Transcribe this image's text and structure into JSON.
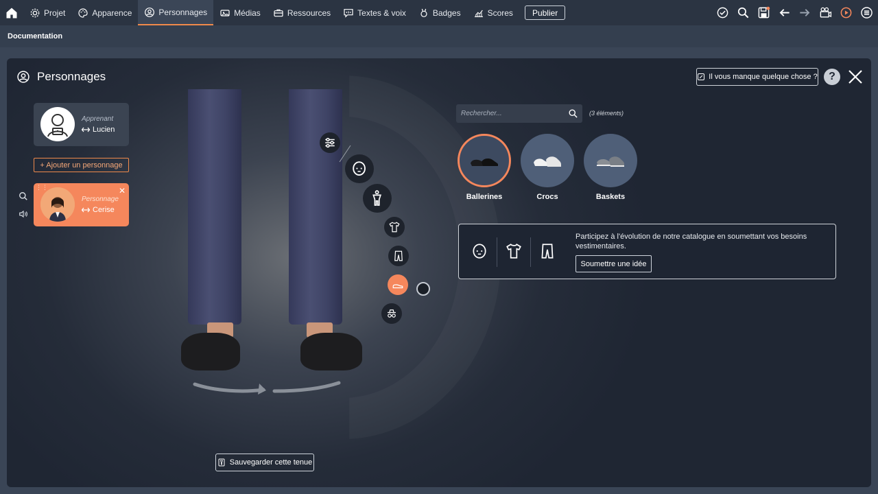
{
  "topbar": {
    "items": [
      {
        "label": "Projet",
        "icon": "gear-icon"
      },
      {
        "label": "Apparence",
        "icon": "palette-icon"
      },
      {
        "label": "Personnages",
        "icon": "person-circle-icon",
        "active": true
      },
      {
        "label": "Médias",
        "icon": "media-icon"
      },
      {
        "label": "Ressources",
        "icon": "briefcase-icon"
      },
      {
        "label": "Textes & voix",
        "icon": "speech-icon"
      },
      {
        "label": "Badges",
        "icon": "badge-icon"
      },
      {
        "label": "Scores",
        "icon": "chart-icon"
      }
    ],
    "publish_label": "Publier"
  },
  "subbar": {
    "title": "Documentation"
  },
  "panel": {
    "title": "Personnages",
    "missing_label": "Il vous manque quelque chose ?",
    "help_label": "?"
  },
  "characters": {
    "learner": {
      "role": "Apprenant",
      "name": "Lucien"
    },
    "add_label": "+ Ajouter un personnage",
    "selected": {
      "role": "Personnage",
      "name": "Cerise"
    }
  },
  "preview": {
    "save_label": "Sauvegarder cette tenue"
  },
  "catalog": {
    "search_placeholder": "Rechercher...",
    "count": "(3 éléments)",
    "items": [
      {
        "label": "Ballerines",
        "selected": true
      },
      {
        "label": "Crocs",
        "selected": false
      },
      {
        "label": "Baskets",
        "selected": false
      }
    ],
    "idea_text": "Participez à l'évolution de notre catalogue en soumettant vos besoins vestimentaires.",
    "idea_button": "Soumettre une idée"
  },
  "colors": {
    "accent": "#f5875c",
    "panel": "#1e2532"
  }
}
